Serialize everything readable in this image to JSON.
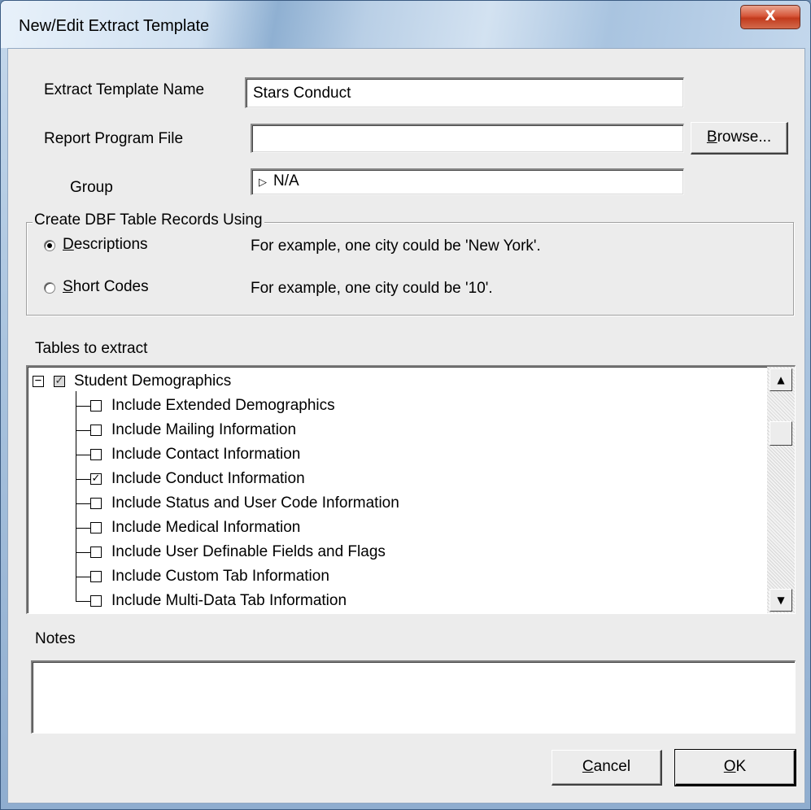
{
  "window": {
    "title": "New/Edit Extract Template",
    "close_glyph": "X"
  },
  "form": {
    "template_name_label": "Extract Template Name",
    "template_name_value": "Stars Conduct",
    "report_file_label": "Report Program File",
    "report_file_value": "",
    "browse_label_first": "B",
    "browse_label_rest": "rowse...",
    "group_label": "Group",
    "group_value": "N/A",
    "group_icon": "triangle-right-icon"
  },
  "record_mode": {
    "legend": "Create DBF Table Records Using",
    "options": [
      {
        "label_first": "D",
        "label_rest": "escriptions",
        "example": "For example, one city could be 'New York'.",
        "selected": true
      },
      {
        "label_first": "S",
        "label_rest": "hort Codes",
        "example": "For example, one city could be '10'.",
        "selected": false
      }
    ]
  },
  "tables": {
    "label": "Tables to extract",
    "root": {
      "label": "Student Demographics",
      "expanded": true,
      "checked": "partial"
    },
    "children": [
      {
        "label": "Include Extended Demographics",
        "checked": false
      },
      {
        "label": "Include Mailing Information",
        "checked": false
      },
      {
        "label": "Include Contact Information",
        "checked": false
      },
      {
        "label": "Include Conduct Information",
        "checked": true
      },
      {
        "label": "Include Status and User Code Information",
        "checked": false
      },
      {
        "label": "Include Medical Information",
        "checked": false
      },
      {
        "label": "Include User Definable Fields and Flags",
        "checked": false
      },
      {
        "label": "Include Custom Tab Information",
        "checked": false
      },
      {
        "label": "Include Multi-Data Tab Information",
        "checked": false
      }
    ]
  },
  "notes": {
    "label": "Notes",
    "value": ""
  },
  "footer": {
    "cancel_first": "C",
    "cancel_rest": "ancel",
    "ok_first": "O",
    "ok_rest": "K"
  }
}
